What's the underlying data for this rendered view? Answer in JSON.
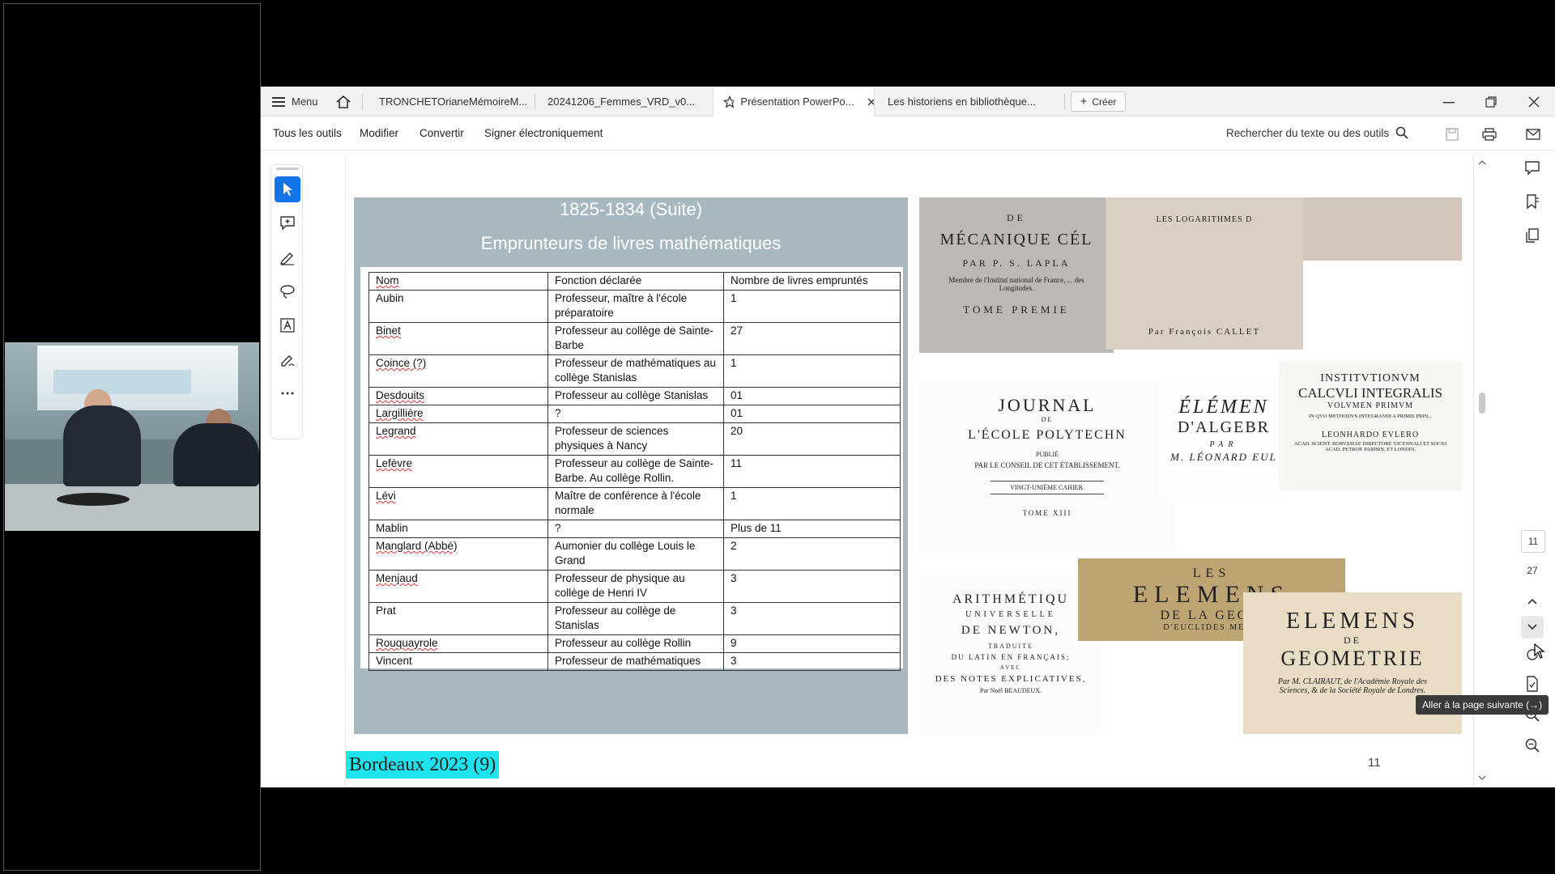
{
  "meeting": {
    "participant_video": "video-feed"
  },
  "app": {
    "menu_label": "Menu",
    "tabs": [
      {
        "label": "TRONCHETOrianeMémoireM..."
      },
      {
        "label": "20241206_Femmes_VRD_v0..."
      },
      {
        "label": "Présentation PowerPo..."
      },
      {
        "label": "Les historiens en bibliothèque..."
      }
    ],
    "create_label": "Créer",
    "toolbar": {
      "all_tools": "Tous les outils",
      "edit": "Modifier",
      "convert": "Convertir",
      "sign": "Signer électroniquement",
      "search": "Rechercher du texte ou des outils"
    },
    "accent_color": "#1473e6"
  },
  "slide": {
    "title_line1": "1825-1834 (Suite)",
    "title_line2": "Emprunteurs de livres mathématiques",
    "headers": [
      "Nom",
      "Fonction déclarée",
      "Nombre de livres empruntés"
    ],
    "rows": [
      [
        "Aubin",
        "Professeur, maître à l'école préparatoire",
        "1"
      ],
      [
        "Binet",
        "Professeur au collège de Sainte-Barbe",
        "27"
      ],
      [
        "Coince (?)",
        "Professeur de mathématiques au collège Stanislas",
        "1"
      ],
      [
        "Desdouits",
        "Professeur au collège Stanislas",
        "01"
      ],
      [
        "Largillière",
        "?",
        "01"
      ],
      [
        "Legrand",
        "Professeur de sciences physiques à Nancy",
        "20"
      ],
      [
        "Lefèvre",
        "Professeur au collège de Sainte-Barbe. Au collège Rollin.",
        "11"
      ],
      [
        "Lévi",
        "Maître de conférence à l'école normale",
        "1"
      ],
      [
        "Mablin",
        "?",
        "Plus de 11"
      ],
      [
        "Manglard (Abbé)",
        "Aumonier du collège Louis le Grand",
        "2"
      ],
      [
        "Menjaud",
        "Professeur de physique au collège de Henri IV",
        "3"
      ],
      [
        "Prat",
        "Professeur au collège de Stanislas",
        "3"
      ],
      [
        "Rouquayrole",
        "Professeur au collège Rollin",
        "9"
      ],
      [
        "Vincent",
        "Professeur de mathématiques",
        "3"
      ]
    ],
    "book_covers": {
      "c1_a": "DE",
      "c1_b": "MÉCANIQUE CÉL",
      "c1_c": "PAR P. S. LAPLA",
      "c1_d": "Membre de l'Institut national de France, ... des Longitudes.",
      "c1_e": "TOME PREMIE",
      "c2_a": "LES LOGARITHMES D",
      "c2_b": "Par François CALLET",
      "c4_a": "JOURNAL",
      "c4_b": "DE",
      "c4_c": "L'ÉCOLE POLYTECHN",
      "c4_d": "PUBLIÉ",
      "c4_e": "PAR LE CONSEIL DE CET ÉTABLISSEMENT.",
      "c4_f": "VINGT-UNIÈME CAHIER.",
      "c4_g": "TOME XIII",
      "c5_a": "ÉLÉMEN",
      "c5_b": "D'ALGEBR",
      "c5_c": "PAR",
      "c5_d": "M. LÉONARD EUL",
      "c6_a": "INSTITVTIONVM",
      "c6_b": "CALCVLI INTEGRALIS",
      "c6_c": "VOLVMEN PRIMVM",
      "c6_d": "IN QVO METHODVS INTEGRANDI A PRIMIS PRIN...",
      "c6_e": "LEONHARDO EVLERO",
      "c6_f": "ACAD. SCIENT. BORVSSIAE DIRECTORE VICENNALI ET SOCIO ACAD. PETROP. PARISIN. ET LONDIN.",
      "c7_a": "ARITHMÉTIQU",
      "c7_b": "UNIVERSELLE",
      "c7_c": "DE NEWTON,",
      "c7_d": "TRADUITE",
      "c7_e": "DU LATIN EN FRANÇAIS;",
      "c7_f": "AVEC",
      "c7_g": "DES NOTES EXPLICATIVES,",
      "c7_h": "Par Noël BEAUDEUX.",
      "c8_a": "LES",
      "c8_b": "ELEMENS",
      "c8_c": "DE LA GEOM",
      "c8_d": "D'EUCLIDES MEGA",
      "c9_a": "ELEMENS",
      "c9_b": "DE",
      "c9_c": "GEOMETRIE",
      "c9_d": "Par M. CLAIRAUT, de l'Académie Royale des Sciences, & de la Société Royale de Londres."
    },
    "caption": "Bordeaux 2023 (9)",
    "page_number": "11"
  },
  "nav": {
    "current_page": "11",
    "total_pages": "27",
    "tooltip": "Aller à la page suivante (→)"
  }
}
